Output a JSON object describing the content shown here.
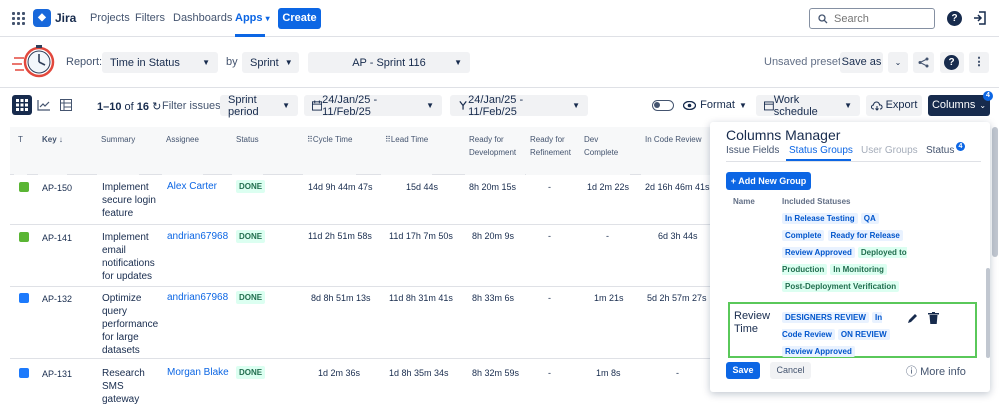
{
  "topnav": {
    "app_name": "Jira",
    "items": [
      "Projects",
      "Filters",
      "Dashboards",
      "Apps"
    ],
    "apps_caret": "⌄",
    "create_label": "Create",
    "search_placeholder": "Search",
    "help_icon": "?"
  },
  "reportbar": {
    "report_label": "Report:",
    "report_value": "Time in Status",
    "by_label": "by",
    "by_value": "Sprint",
    "sprint_value": "AP - Sprint 116",
    "unsaved_preset": "Unsaved preset",
    "save_as": "Save as",
    "help_icon": "?"
  },
  "filterbar": {
    "count_prefix": "1–10",
    "count_of": "of",
    "count_total": "16",
    "filter_label": "Filter issues:",
    "sprint_period": "Sprint period",
    "date_range_1": "24/Jan/25 - 11/Feb/25",
    "date_range_2": "24/Jan/25 - 11/Feb/25",
    "format_label": "Format",
    "work_schedule_label": "Work schedule",
    "export_label": "Export",
    "columns_label": "Columns",
    "columns_badge": "4"
  },
  "table": {
    "headers": {
      "type": "T",
      "key": "Key",
      "key_sort": "↓",
      "summary": "Summary",
      "assignee": "Assignee",
      "status": "Status",
      "cycle": "Cycle Time",
      "lead": "Lead Time",
      "ready_dev": "Ready for Development",
      "ready_ref": "Ready for Refinement",
      "dev_complete": "Dev Complete",
      "in_code_review": "In Code Review"
    },
    "rows": [
      {
        "key": "AP-150",
        "summary": "Implement secure login feature",
        "assignee": "Alex Carter",
        "status": "DONE",
        "cycle": "14d 9h 44m 47s",
        "lead": "15d 44s",
        "ready_dev": "8h 20m 15s",
        "ready_ref": "-",
        "dev_complete": "1d 2m 22s",
        "code_review": "2d 16h 46m 41s",
        "type": "story"
      },
      {
        "key": "AP-141",
        "summary": "Implement email notifications for updates",
        "assignee": "andrian67968",
        "status": "DONE",
        "cycle": "11d 2h 51m 58s",
        "lead": "11d 17h 7m 50s",
        "ready_dev": "8h 20m 9s",
        "ready_ref": "-",
        "dev_complete": "-",
        "code_review": "6d 3h 44s",
        "type": "story"
      },
      {
        "key": "AP-132",
        "summary": "Optimize query performance for large datasets",
        "assignee": "andrian67968",
        "status": "DONE",
        "cycle": "8d 8h 51m 13s",
        "lead": "11d 8h 31m 41s",
        "ready_dev": "8h 33m 6s",
        "ready_ref": "-",
        "dev_complete": "1m 21s",
        "code_review": "5d 2h 57m 27s",
        "type": "task"
      },
      {
        "key": "AP-131",
        "summary": "Research SMS gateway",
        "assignee": "Morgan Blake",
        "status": "DONE",
        "cycle": "1d 2m 36s",
        "lead": "1d 8h 35m 34s",
        "ready_dev": "8h 32m 59s",
        "ready_ref": "-",
        "dev_complete": "1m 8s",
        "code_review": "-",
        "type": "task"
      }
    ]
  },
  "panel": {
    "title": "Columns Manager",
    "tabs": [
      "Issue Fields",
      "Status Groups",
      "User Groups",
      "Status"
    ],
    "status_badge": "4",
    "add_group": "+ Add New Group",
    "col_name": "Name",
    "col_statuses": "Included Statuses",
    "group1_statuses": [
      {
        "text": "In Release Testing",
        "color": "blue"
      },
      {
        "text": "QA",
        "color": "blue"
      },
      {
        "text": "Complete",
        "color": "blue"
      },
      {
        "text": "Ready for Release",
        "color": "blue"
      },
      {
        "text": "Review Approved",
        "color": "blue"
      },
      {
        "text": "Deployed to Production",
        "color": "green"
      },
      {
        "text": "In Monitoring",
        "color": "green"
      },
      {
        "text": "Post-Deployment Verification",
        "color": "green"
      }
    ],
    "group2_name": "Review Time",
    "group2_statuses": [
      "DESIGNERS REVIEW",
      "In Code Review",
      "ON REVIEW",
      "Review Approved"
    ],
    "save": "Save",
    "cancel": "Cancel",
    "more_info": "More info"
  },
  "colors": {
    "accent": "#0c66e4",
    "done_bg": "#dcfff1",
    "done_text": "#216e4e",
    "highlight": "#5ac85a"
  }
}
